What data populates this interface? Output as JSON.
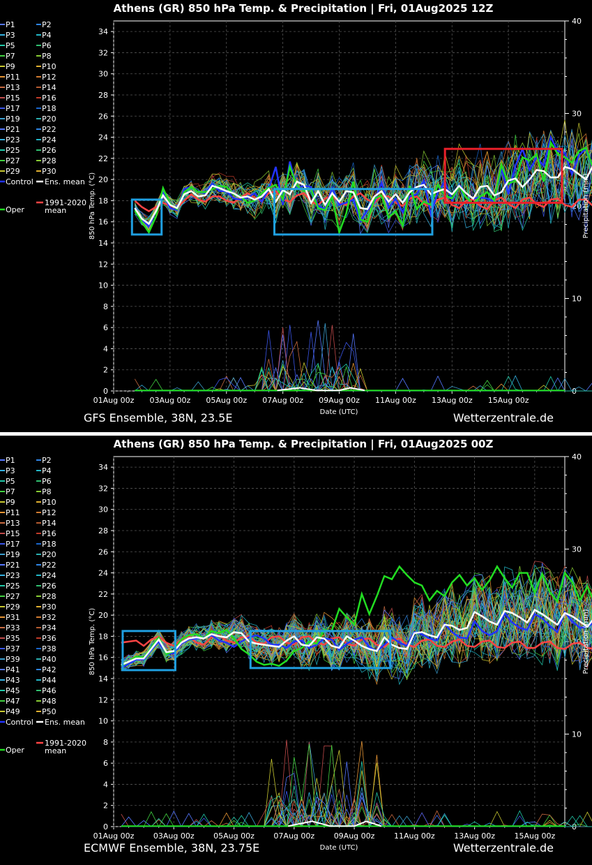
{
  "chart_data": [
    {
      "type": "line",
      "title": "Athens  (GR)  850 hPa Temp. & Precipitation | Fri, 01Aug2025 12Z",
      "model_label": "GFS Ensemble, 38N, 23.5E",
      "source_label": "Wetterzentrale.de",
      "xlabel": "Date (UTC)",
      "ylabel": "850 hPa Temp. (°C)",
      "y2label": "Precipitation (mm)",
      "xlim_days": [
        0,
        16
      ],
      "ylim": [
        0,
        35
      ],
      "y2lim": [
        0,
        40
      ],
      "x_ticks": [
        "01Aug 00z",
        "03Aug 00z",
        "05Aug 00z",
        "07Aug 00z",
        "09Aug 00z",
        "11Aug 00z",
        "13Aug 00z",
        "15Aug 00z"
      ],
      "y_ticks": [
        0,
        2,
        4,
        6,
        8,
        10,
        12,
        14,
        16,
        18,
        20,
        22,
        24,
        26,
        28,
        30,
        32,
        34
      ],
      "y2_ticks": [
        0,
        10,
        20,
        30,
        40
      ],
      "legend": {
        "members": [
          "P1",
          "P2",
          "P3",
          "P4",
          "P5",
          "P6",
          "P7",
          "P8",
          "P9",
          "P10",
          "P11",
          "P12",
          "P13",
          "P14",
          "P15",
          "P16",
          "P17",
          "P18",
          "P19",
          "P20",
          "P21",
          "P22",
          "P23",
          "P24",
          "P25",
          "P26",
          "P27",
          "P28",
          "P29",
          "P30"
        ],
        "control": "Control",
        "ens_mean": "Ens. mean",
        "oper": "Oper",
        "climate_line1": "1991-2020",
        "climate_line2": "mean"
      },
      "start_day": 0.75,
      "step_days": 0.25,
      "ens_mean": [
        17.3,
        16.3,
        15.8,
        17.0,
        18.5,
        17.6,
        17.3,
        18.6,
        18.9,
        18.4,
        18.5,
        19.4,
        19.2,
        18.9,
        18.7,
        18.3,
        18.4,
        18.1,
        18.4,
        19.1,
        17.9,
        19.0,
        18.6,
        19.8,
        19.5,
        17.8,
        18.9,
        17.6,
        18.7,
        17.9,
        18.9,
        18.8,
        17.3,
        17.2,
        18.4,
        18.9,
        17.9,
        18.6,
        17.8,
        18.8,
        19.3,
        19.5,
        18.6,
        18.9,
        19.1,
        18.6,
        19.4,
        18.7,
        18.2,
        19.3,
        19.4,
        18.5,
        18.8,
        19.9,
        20.1,
        19.3,
        20.0,
        20.9,
        20.8,
        20.2,
        20.2,
        21.2,
        21.0,
        20.5,
        20.0,
        21.3,
        21.0,
        20.0
      ],
      "oper": [
        17.1,
        16.0,
        15.0,
        16.5,
        19.2,
        17.7,
        17.2,
        18.8,
        19.3,
        18.8,
        18.8,
        19.1,
        19.4,
        19.3,
        18.6,
        18.4,
        17.8,
        18.0,
        18.7,
        19.2,
        19.5,
        18.1,
        21.2,
        19.4,
        18.9,
        19.1,
        17.3,
        17.1,
        18.4,
        15.0,
        16.8,
        19.8,
        16.2,
        16.0,
        18.2,
        18.5,
        16.4,
        17.0,
        15.6,
        19.4,
        17.2,
        17.9,
        17.6,
        19.5,
        18.5,
        18.2,
        19.4,
        18.3,
        17.7,
        18.4,
        18.8,
        18.0,
        21.4,
        19.6,
        19.9,
        22.1,
        21.8,
        22.4,
        19.8,
        23.5,
        22.4,
        22.1,
        21.6,
        22.7,
        23.0,
        21.1,
        21.3,
        21.6
      ],
      "control": [
        17.3,
        16.2,
        15.6,
        17.0,
        18.7,
        17.3,
        17.1,
        19.1,
        19.3,
        18.8,
        18.7,
        19.6,
        18.9,
        18.9,
        18.2,
        18.1,
        18.3,
        18.7,
        17.9,
        19.1,
        21.2,
        17.6,
        21.7,
        19.2,
        19.4,
        19.3,
        17.5,
        17.2,
        19.2,
        17.6,
        17.8,
        18.1,
        16.1,
        17.1,
        17.9,
        19.7,
        17.3,
        18.2,
        16.9,
        18.4,
        18.6,
        19.9,
        16.7,
        18.8,
        19.8,
        18.0,
        19.5,
        18.7,
        18.2,
        18.3,
        18.2,
        17.9,
        21.1,
        18.6,
        21.3,
        22.9,
        20.9,
        22.1,
        21.3,
        24.0,
        22.7,
        22.5,
        20.5,
        22.3,
        22.9,
        21.0,
        22.0,
        21.5
      ],
      "climate_mean": [
        18.0,
        17.4,
        17.0,
        17.4,
        17.8,
        17.5,
        17.3,
        18.0,
        18.6,
        18.1,
        17.9,
        18.4,
        18.4,
        18.0,
        17.8,
        18.3,
        18.7,
        18.3,
        18.0,
        18.7,
        18.9,
        18.1,
        17.9,
        18.5,
        18.7,
        17.9,
        17.6,
        18.2,
        18.5,
        17.8,
        17.6,
        18.4,
        18.7,
        18.1,
        17.8,
        18.5,
        18.4,
        17.8,
        17.5,
        18.2,
        18.4,
        17.7,
        17.4,
        18.1,
        18.3,
        17.6,
        17.3,
        18.0,
        18.1,
        17.5,
        17.2,
        18.0,
        18.3,
        17.7,
        17.3,
        18.1,
        18.3,
        17.7,
        17.4,
        18.1,
        18.2,
        17.6,
        17.4,
        18.1,
        18.1,
        17.5,
        17.5,
        17.8
      ],
      "precip_member_peak": 6.9,
      "precip_mean_peak": 0.3,
      "boxes": [
        {
          "color": "#1f9fe0",
          "day_from": 0.65,
          "day_to": 1.7,
          "temp_from": 14.8,
          "temp_to": 18.1
        },
        {
          "color": "#1f9fe0",
          "day_from": 5.7,
          "day_to": 11.3,
          "temp_from": 14.8,
          "temp_to": 19.1
        },
        {
          "color": "#e8202a",
          "day_from": 11.75,
          "day_to": 15.9,
          "temp_from": 17.8,
          "temp_to": 22.9
        }
      ]
    },
    {
      "type": "line",
      "title": "Athens  (GR)  850 hPa Temp. & Precipitation | Fri, 01Aug2025 00Z",
      "model_label": "ECMWF Ensemble, 38N, 23.75E",
      "source_label": "Wetterzentrale.de",
      "xlabel": "Date (UTC)",
      "ylabel": "850 hPa Temp. (°C)",
      "y2label": "Precipitation (mm)",
      "xlim_days": [
        0,
        15
      ],
      "ylim": [
        0,
        35
      ],
      "y2lim": [
        0,
        40
      ],
      "x_ticks": [
        "01Aug 00z",
        "03Aug 00z",
        "05Aug 00z",
        "07Aug 00z",
        "09Aug 00z",
        "11Aug 00z",
        "13Aug 00z",
        "15Aug 00z"
      ],
      "y_ticks": [
        0,
        2,
        4,
        6,
        8,
        10,
        12,
        14,
        16,
        18,
        20,
        22,
        24,
        26,
        28,
        30,
        32,
        34
      ],
      "y2_ticks": [
        0,
        10,
        20,
        30,
        40
      ],
      "legend": {
        "members": [
          "P1",
          "P2",
          "P3",
          "P4",
          "P5",
          "P6",
          "P7",
          "P8",
          "P9",
          "P10",
          "P11",
          "P12",
          "P13",
          "P14",
          "P15",
          "P16",
          "P17",
          "P18",
          "P19",
          "P20",
          "P21",
          "P22",
          "P23",
          "P24",
          "P25",
          "P26",
          "P27",
          "P28",
          "P29",
          "P30",
          "P31",
          "P32",
          "P33",
          "P34",
          "P35",
          "P36",
          "P37",
          "P38",
          "P39",
          "P40",
          "P41",
          "P42",
          "P43",
          "P44",
          "P45",
          "P46",
          "P47",
          "P48",
          "P49",
          "P50"
        ],
        "control": "Control",
        "ens_mean": "Ens. mean",
        "oper": "Oper",
        "climate_line1": "1991-2020",
        "climate_line2": "mean"
      },
      "start_day": 0.25,
      "step_days": 0.25,
      "ens_mean": [
        15.3,
        15.6,
        15.9,
        15.9,
        16.8,
        17.7,
        16.5,
        16.6,
        17.4,
        17.8,
        17.9,
        17.8,
        18.2,
        18.0,
        17.9,
        18.4,
        18.3,
        17.5,
        17.3,
        17.2,
        17.1,
        17.0,
        17.6,
        18.0,
        17.2,
        17.1,
        17.9,
        17.8,
        17.1,
        16.9,
        18.0,
        17.6,
        17.1,
        16.8,
        16.6,
        17.9,
        17.2,
        16.9,
        16.8,
        18.3,
        18.4,
        18.1,
        17.9,
        19.1,
        19.0,
        18.6,
        18.8,
        20.3,
        19.9,
        19.4,
        19.1,
        20.4,
        20.2,
        19.8,
        19.3,
        20.5,
        20.1,
        19.6,
        19.1,
        20.2,
        19.9,
        19.4,
        18.9,
        19.8
      ],
      "oper": [
        15.2,
        15.6,
        16.1,
        16.0,
        16.9,
        17.9,
        16.3,
        16.6,
        17.7,
        18.1,
        18.2,
        17.8,
        18.5,
        18.3,
        18.6,
        17.8,
        16.8,
        16.3,
        15.6,
        15.3,
        15.4,
        15.2,
        15.7,
        16.6,
        16.9,
        17.5,
        17.3,
        18.6,
        18.5,
        20.6,
        19.8,
        19.1,
        22.0,
        20.1,
        21.8,
        23.7,
        23.4,
        24.6,
        23.8,
        23.1,
        22.8,
        21.4,
        22.3,
        21.8,
        23.1,
        23.8,
        22.8,
        23.5,
        22.4,
        23.3,
        24.6,
        23.5,
        22.6,
        24.0,
        24.0,
        22.1,
        23.9,
        22.2,
        21.3,
        24.0,
        23.1,
        21.4,
        22.7,
        21.1
      ],
      "control": [
        15.0,
        15.4,
        15.8,
        15.8,
        16.7,
        17.5,
        16.3,
        16.4,
        17.3,
        17.7,
        17.8,
        17.9,
        18.1,
        17.6,
        17.4,
        17.0,
        17.5,
        17.9,
        18.1,
        17.8,
        17.2,
        17.2,
        16.9,
        17.5,
        17.6,
        16.9,
        17.2,
        17.8,
        17.7,
        16.7,
        17.3,
        17.7,
        17.9,
        17.0,
        16.6,
        17.2,
        17.9,
        17.4,
        17.1,
        18.4,
        18.2,
        17.8,
        17.6,
        19.2,
        18.4,
        17.9,
        17.8,
        19.4,
        18.5,
        18.1,
        18.5,
        20.2,
        19.3,
        18.8,
        18.6,
        20.1,
        19.7,
        19.0,
        18.4,
        20.3,
        19.4,
        18.8,
        18.9,
        19.4
      ],
      "climate_mean": [
        17.4,
        17.5,
        17.6,
        17.1,
        17.7,
        18.0,
        17.4,
        17.1,
        17.7,
        18.0,
        17.4,
        17.2,
        17.9,
        18.1,
        17.6,
        17.4,
        17.9,
        18.0,
        17.4,
        17.3,
        17.9,
        18.0,
        17.4,
        17.2,
        17.9,
        18.0,
        17.4,
        17.2,
        17.8,
        17.9,
        17.3,
        17.1,
        17.7,
        17.8,
        17.2,
        17.0,
        17.6,
        17.8,
        17.2,
        17.0,
        17.6,
        17.7,
        17.1,
        17.0,
        17.5,
        17.7,
        17.1,
        17.0,
        17.5,
        17.6,
        17.0,
        16.9,
        17.4,
        17.5,
        16.9,
        16.9,
        17.4,
        17.5,
        16.9,
        16.8,
        17.3,
        17.4,
        16.9,
        16.8
      ],
      "precip_member_peak": 8.3,
      "precip_mean_peak": 0.5,
      "boxes": [
        {
          "color": "#1f9fe0",
          "day_from": 0.3,
          "day_to": 2.05,
          "temp_from": 14.8,
          "temp_to": 18.5
        },
        {
          "color": "#1f9fe0",
          "day_from": 4.55,
          "day_to": 9.2,
          "temp_from": 15.0,
          "temp_to": 18.5
        }
      ]
    }
  ],
  "colors": {
    "ens_mean": "#ffffff",
    "oper": "#22dd22",
    "control": "#2233ff",
    "climate_mean": "#ff4444",
    "grid": "#555555"
  }
}
